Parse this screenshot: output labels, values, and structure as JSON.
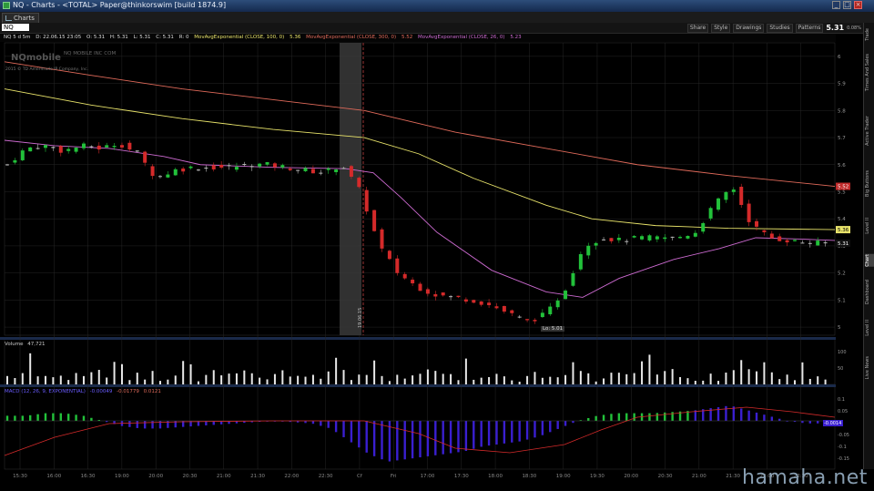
{
  "window": {
    "title": "NQ - Charts - <TOTAL> Paper@thinkorswim [build 1874.9]"
  },
  "tab": {
    "label": "Charts"
  },
  "toolbar": {
    "symbol": "NQ",
    "share_label": "Share",
    "style_label": "Style",
    "drawings_label": "Drawings",
    "studies_label": "Studies",
    "patterns_label": "Patterns",
    "last_price": "5.31",
    "last_price_extra": "0.08%"
  },
  "infobar": {
    "symbol_time": "NQ 5 d 5m",
    "date_time": "D: 22.06.15 23:05",
    "open": "O: 5.31",
    "high": "H: 5.31",
    "low": "L: 5.31",
    "close": "C: 5.31",
    "range": "R: 0",
    "ema1": "MovAvgExponential (CLOSE, 100, 0)",
    "ema1_val": "5.36",
    "ema2": "MovAvgExponential (CLOSE, 300, 0)",
    "ema2_val": "5.52",
    "ema3": "MovAvgExponential (CLOSE, 26, 0)",
    "ema3_val": "5.23"
  },
  "logo": {
    "text": "NQmobile",
    "copyright": "2015 © TD Ameritrade IP Company, Inc."
  },
  "company": "NQ MOBILE INC COM",
  "colors": {
    "up": "#22c13a",
    "down": "#d42a2a",
    "ema100": "#e8e36a",
    "ema300": "#e06a5a",
    "ema26": "#cc6ad0",
    "macd_up": "#22c13a",
    "macd_down": "#3a1fd0",
    "grid": "#262626"
  },
  "price_axis": {
    "labels": [
      "6",
      "5.9",
      "5.8",
      "5.7",
      "5.6",
      "5.5",
      "5.4",
      "5.3",
      "5.2",
      "5.1",
      "5"
    ],
    "tags": {
      "ema300": "5.52",
      "ema100": "5.36",
      "last": "5.31"
    }
  },
  "low_label": "Lo: 5.01",
  "session_label": "19.06.15",
  "volume": {
    "label": "Volume",
    "value": "47,721",
    "axis": [
      "100",
      "50"
    ]
  },
  "macd": {
    "legend": [
      "MACD (12, 26, 9, EXPONENTIAL)",
      "-0.00049",
      "-0.01779",
      "0.0121"
    ],
    "axis": [
      "0.1",
      "0.05",
      "0",
      "-0.05",
      "-0.1",
      "-0.15"
    ],
    "tag": "-0.0014"
  },
  "time_axis": [
    "15:30",
    "16:00",
    "16:30",
    "19:00",
    "20:00",
    "20:30",
    "21:00",
    "21:30",
    "22:00",
    "22:30",
    "Cf",
    "Fri",
    "17:00",
    "17:30",
    "18:00",
    "18:30",
    "19:00",
    "19:30",
    "20:00",
    "20:30",
    "21:00",
    "21:30",
    "22:00",
    "22:30"
  ],
  "right_tabs": [
    "Trade",
    "Times And Sales",
    "Active Trader",
    "Big Buttons",
    "Level II",
    "Chart",
    "Dashboard",
    "Level II",
    "Live News"
  ],
  "watermark": "hamaha.net"
}
